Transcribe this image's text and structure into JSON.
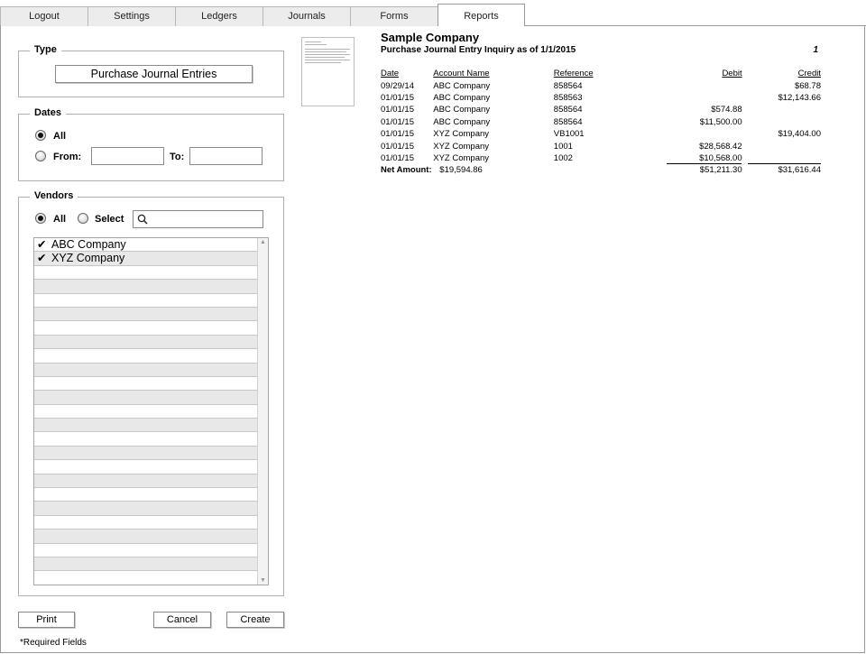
{
  "tabs": [
    "Logout",
    "Settings",
    "Ledgers",
    "Journals",
    "Forms",
    "Reports"
  ],
  "active_tab": "Reports",
  "type_group": {
    "legend": "Type",
    "selected_type": "Purchase Journal Entries"
  },
  "dates_group": {
    "legend": "Dates",
    "all_label": "All",
    "from_label": "From:",
    "to_label": "To:",
    "from_value": "",
    "to_value": "",
    "selected": "All"
  },
  "vendors_group": {
    "legend": "Vendors",
    "all_label": "All",
    "select_label": "Select",
    "selected": "All",
    "search_value": "",
    "vendors": [
      {
        "name": "ABC Company",
        "checked": true
      },
      {
        "name": "XYZ Company",
        "checked": true
      }
    ]
  },
  "buttons": {
    "print": "Print",
    "cancel": "Cancel",
    "create": "Create"
  },
  "required_note": "*Required Fields",
  "report": {
    "company": "Sample Company",
    "subtitle": "Purchase Journal Entry Inquiry as of  1/1/2015",
    "page_number": "1",
    "columns": {
      "date": "Date",
      "account": "Account Name",
      "reference": "Reference",
      "debit": "Debit",
      "credit": "Credit"
    },
    "rows": [
      {
        "date": "09/29/14",
        "account": "ABC Company",
        "reference": "858564",
        "debit": "",
        "credit": "$68.78"
      },
      {
        "date": "01/01/15",
        "account": "ABC Company",
        "reference": "858563",
        "debit": "",
        "credit": "$12,143.66"
      },
      {
        "date": "01/01/15",
        "account": "ABC Company",
        "reference": "858564",
        "debit": "$574.88",
        "credit": ""
      },
      {
        "date": "01/01/15",
        "account": "ABC Company",
        "reference": "858564",
        "debit": "$11,500.00",
        "credit": ""
      },
      {
        "date": "01/01/15",
        "account": "XYZ Company",
        "reference": "VB1001",
        "debit": "",
        "credit": "$19,404.00"
      },
      {
        "date": "01/01/15",
        "account": "XYZ Company",
        "reference": "1001",
        "debit": "$28,568.42",
        "credit": ""
      },
      {
        "date": "01/01/15",
        "account": "XYZ Company",
        "reference": "1002",
        "debit": "$10,568.00",
        "credit": ""
      }
    ],
    "net_label": "Net Amount:",
    "net_value": "$19,594.86",
    "total_debit": "$51,211.30",
    "total_credit": "$31,616.44"
  }
}
